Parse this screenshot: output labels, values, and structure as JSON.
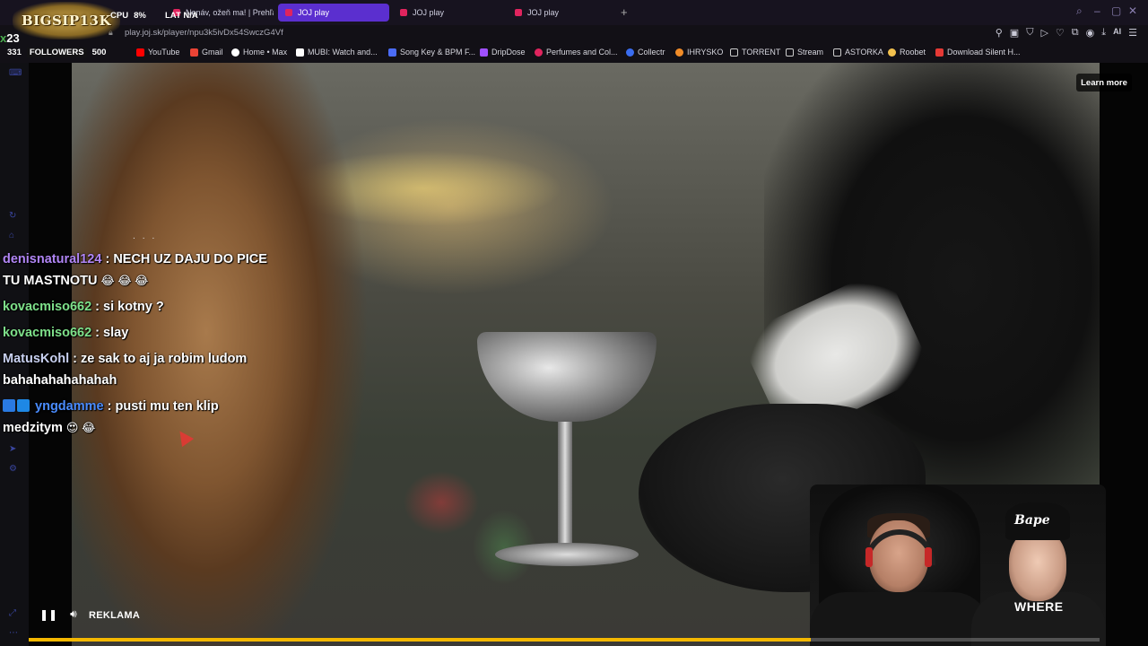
{
  "browser": {
    "tabs": [
      {
        "label": "Nenáv, ožeň ma! | Prehľad",
        "active": false
      },
      {
        "label": "JOJ play",
        "active": true
      },
      {
        "label": "JOJ play",
        "active": false
      },
      {
        "label": "JOJ play",
        "active": false
      }
    ],
    "url": "play.joj.sk/player/npu3k5ivDx54SwczG4Vf",
    "bookmarks": [
      {
        "label": "YouTube",
        "color": "#ff0000"
      },
      {
        "label": "Gmail",
        "color": "#ea4335"
      },
      {
        "label": "Home • Max",
        "color": "#ffffff"
      },
      {
        "label": "MUBI: Watch and...",
        "color": "#ffffff"
      },
      {
        "label": "Song Key & BPM F...",
        "color": "#4b6cf7"
      },
      {
        "label": "DripDose",
        "color": "#a050ff"
      },
      {
        "label": "Perfumes and Col...",
        "color": "#e0245e"
      },
      {
        "label": "Collectr",
        "color": "#3a6df0"
      },
      {
        "label": "IHRYSKO",
        "color": "#f28c28"
      },
      {
        "label": "TORRENT",
        "color": "#cccccc"
      },
      {
        "label": "Stream",
        "color": "#cccccc"
      },
      {
        "label": "ASTORKA",
        "color": "#cccccc"
      },
      {
        "label": "Roobet",
        "color": "#f2c14e"
      },
      {
        "label": "Download Silent H...",
        "color": "#e53935"
      }
    ]
  },
  "overlay": {
    "logo_text": "BIGSIP13K",
    "kills": "23",
    "kills_prefix": "x",
    "cpu_label": "CPU",
    "cpu_value": "8%",
    "lat_label": "LAT",
    "lat_value": "N/A",
    "followers_count": "331",
    "followers_label": "FOLLOWERS",
    "followers_goal": "500"
  },
  "chat": {
    "messages": [
      {
        "user": "denisnatural124",
        "color": "#b085f5",
        "text": "NECH UZ DAJU DO PICE TU MASTNOTU",
        "emojis": "😂 😂 😂"
      },
      {
        "user": "kovacmiso662",
        "color": "#7ee08a",
        "text": "si kotny ?",
        "emojis": ""
      },
      {
        "user": "kovacmiso662",
        "color": "#7ee08a",
        "text": "slay",
        "emojis": ""
      },
      {
        "user": "MatusKohl",
        "color": "#c8d0f0",
        "text": "ze sak to aj ja robim ludom bahahahahahahah",
        "emojis": ""
      },
      {
        "user": "yngdamme",
        "color": "#4a8cff",
        "text": "pusti mu ten klip medzitym",
        "emojis": "😍 😂"
      }
    ]
  },
  "player": {
    "learn_more": "Learn more",
    "ad_label": "REKLAMA",
    "progress": 0.73,
    "progress_color": "#f5b800"
  },
  "webcam": {
    "cap_text": "Bape",
    "shirt_text": "WHERE"
  }
}
